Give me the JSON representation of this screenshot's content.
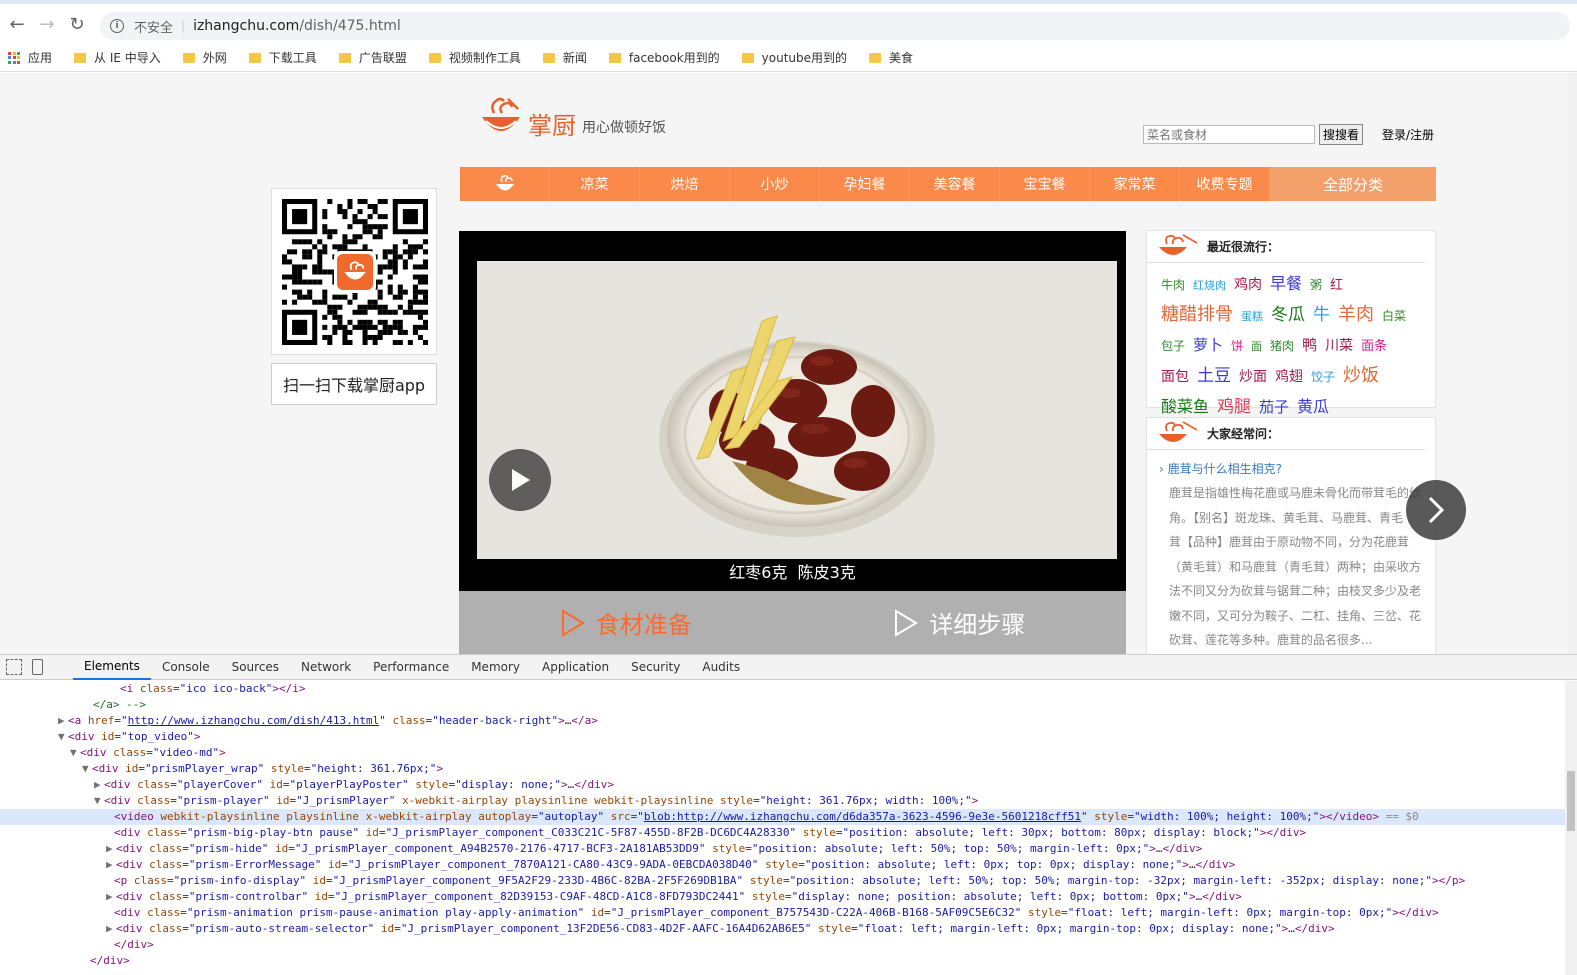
{
  "browser": {
    "security_label": "不安全",
    "url_host": "izhangchu.com",
    "url_path": "/dish/475.html",
    "bookmarks": [
      {
        "label": "应用",
        "icon": "apps-grid-icon"
      },
      {
        "label": "从 IE 中导入",
        "icon": "folder-icon"
      },
      {
        "label": "外网",
        "icon": "folder-icon"
      },
      {
        "label": "下载工具",
        "icon": "folder-icon"
      },
      {
        "label": "广告联盟",
        "icon": "folder-icon"
      },
      {
        "label": "视频制作工具",
        "icon": "folder-icon"
      },
      {
        "label": "新闻",
        "icon": "folder-icon"
      },
      {
        "label": "facebook用到的",
        "icon": "folder-icon"
      },
      {
        "label": "youtube用到的",
        "icon": "folder-icon"
      },
      {
        "label": "美食",
        "icon": "folder-icon"
      }
    ]
  },
  "site": {
    "logo_name": "掌厨",
    "logo_slogan": "用心做顿好饭",
    "search_placeholder": "菜名或食材",
    "search_button": "搜搜看",
    "login": "登录/注册",
    "nav": [
      "凉菜",
      "烘焙",
      "小炒",
      "孕妇餐",
      "美容餐",
      "宝宝餐",
      "家常菜",
      "收费专题"
    ],
    "nav_all": "全部分类",
    "qr_caption": "扫一扫下载掌厨app",
    "video_subtitle": "红枣6克  陈皮3克",
    "video_tabs": [
      "食材准备",
      "详细步骤"
    ],
    "popular": {
      "title": "最近很流行：",
      "tags": [
        {
          "t": "牛肉",
          "c": "#2e8b2e",
          "s": 12
        },
        {
          "t": "红烧肉",
          "c": "#2aa0d8",
          "s": 11
        },
        {
          "t": "鸡肉",
          "c": "#a01c4c",
          "s": 14
        },
        {
          "t": "早餐",
          "c": "#3b3bd8",
          "s": 16
        },
        {
          "t": "粥",
          "c": "#2e8b2e",
          "s": 12
        },
        {
          "t": "红",
          "c": "#a01c4c",
          "s": 13
        },
        {
          "t": "糖醋排骨",
          "c": "#e06a3a",
          "s": 18
        },
        {
          "t": "蛋糕",
          "c": "#2aa0d8",
          "s": 11
        },
        {
          "t": "冬瓜",
          "c": "#1a7a1a",
          "s": 17
        },
        {
          "t": "牛",
          "c": "#2aa0d8",
          "s": 17
        },
        {
          "t": "羊肉",
          "c": "#e06a3a",
          "s": 18
        },
        {
          "t": "白菜",
          "c": "#2e8b2e",
          "s": 12
        },
        {
          "t": "包子",
          "c": "#2e8b2e",
          "s": 12
        },
        {
          "t": "萝卜",
          "c": "#3b3bd8",
          "s": 15
        },
        {
          "t": "饼",
          "c": "#d81c8c",
          "s": 12
        },
        {
          "t": "面",
          "c": "#2e8b2e",
          "s": 11
        },
        {
          "t": "猪肉",
          "c": "#2e8b2e",
          "s": 12
        },
        {
          "t": "鸭",
          "c": "#a01c4c",
          "s": 15
        },
        {
          "t": "川菜",
          "c": "#a01c4c",
          "s": 14
        },
        {
          "t": "面条",
          "c": "#d81c8c",
          "s": 13
        },
        {
          "t": "面包",
          "c": "#a01c4c",
          "s": 14
        },
        {
          "t": "土豆",
          "c": "#3b3bd8",
          "s": 17
        },
        {
          "t": "炒面",
          "c": "#a01c4c",
          "s": 14
        },
        {
          "t": "鸡翅",
          "c": "#a01c4c",
          "s": 14
        },
        {
          "t": "饺子",
          "c": "#2aa0d8",
          "s": 12
        },
        {
          "t": "炒饭",
          "c": "#e06a3a",
          "s": 18
        },
        {
          "t": "酸菜鱼",
          "c": "#1a7a1a",
          "s": 16
        },
        {
          "t": "鸡腿",
          "c": "#e03a5a",
          "s": 17
        },
        {
          "t": "茄子",
          "c": "#3b3bd8",
          "s": 15
        },
        {
          "t": "黄瓜",
          "c": "#3b3bd8",
          "s": 16
        }
      ]
    },
    "faq": {
      "title": "大家经常问：",
      "question": "鹿茸与什么相生相克?",
      "answer_lines": [
        "鹿茸是指雄性梅花鹿或马鹿未骨化而带茸毛的幼",
        "角。【别名】斑龙珠、黄毛茸、马鹿茸、青毛",
        "茸【品种】鹿茸由于原动物不同，分为花鹿茸",
        "（黄毛茸）和马鹿茸（青毛茸）两种；由采收方",
        "法不同又分为砍茸与锯茸二种；由枝叉多少及老",
        "嫩不同，又可分为鞍子、二杠、挂角、三岔、花",
        "砍茸、莲花等多种。鹿茸的品名很多..."
      ]
    }
  },
  "devtools": {
    "tabs": [
      "Elements",
      "Console",
      "Sources",
      "Network",
      "Performance",
      "Memory",
      "Application",
      "Security",
      "Audits"
    ],
    "active_tab": "Elements",
    "lines": [
      {
        "indent": 120,
        "tw": "",
        "html": "<span class='tg'>&lt;i</span> <span class='at'>class</span>=<span class='av'>\"ico ico-back\"</span><span class='tg'>&gt;&lt;/i&gt;</span>"
      },
      {
        "indent": 93,
        "tw": "",
        "html": "<span class='cm'>&lt;/a&gt; --&gt;</span>"
      },
      {
        "indent": 58,
        "tw": "▶",
        "html": "<span class='tg'>&lt;a</span> <span class='at'>href</span>=<span class='av'>\"</span><span class='lk'>http://www.izhangchu.com/dish/413.html</span><span class='av'>\"</span> <span class='at'>class</span>=<span class='av'>\"header-back-right\"</span><span class='tg'>&gt;</span>…<span class='tg'>&lt;/a&gt;</span>"
      },
      {
        "indent": 58,
        "tw": "▼",
        "html": "<span class='tg'>&lt;div</span> <span class='at'>id</span>=<span class='av'>\"top_video\"</span><span class='tg'>&gt;</span>"
      },
      {
        "indent": 70,
        "tw": "▼",
        "html": "<span class='tg'>&lt;div</span> <span class='at'>class</span>=<span class='av'>\"video-md\"</span><span class='tg'>&gt;</span>"
      },
      {
        "indent": 82,
        "tw": "▼",
        "html": "<span class='tg'>&lt;div</span> <span class='at'>id</span>=<span class='av'>\"prismPlayer_wrap\"</span> <span class='at'>style</span>=<span class='av'>\"height: 361.76px;\"</span><span class='tg'>&gt;</span>"
      },
      {
        "indent": 94,
        "tw": "▶",
        "html": "<span class='tg'>&lt;div</span> <span class='at'>class</span>=<span class='av'>\"playerCover\"</span> <span class='at'>id</span>=<span class='av'>\"playerPlayPoster\"</span> <span class='at'>style</span>=<span class='av'>\"display: none;\"</span><span class='tg'>&gt;</span>…<span class='tg'>&lt;/div&gt;</span>"
      },
      {
        "indent": 94,
        "tw": "▼",
        "html": "<span class='tg'>&lt;div</span> <span class='at'>class</span>=<span class='av'>\"prism-player\"</span> <span class='at'>id</span>=<span class='av'>\"J_prismPlayer\"</span> <span class='at'>x-webkit-airplay playsinline webkit-playsinline style</span>=<span class='av'>\"height: 361.76px; width: 100%;\"</span><span class='tg'>&gt;</span>"
      },
      {
        "indent": 114,
        "tw": "",
        "sel": true,
        "html": "<span class='tg'>&lt;video</span> <span class='at'>webkit-playsinline playsinline x-webkit-airplay autoplay</span>=<span class='av'>\"autoplay\"</span> <span class='at'>src</span>=<span class='av'>\"</span><span class='lk'>blob:http://www.izhangchu.com/d6da357a-3623-4596-9e3e-5601218cff51</span><span class='av'>\"</span> <span class='at'>style</span>=<span class='av'>\"width: 100%; height: 100%;\"</span><span class='tg'>&gt;&lt;/video&gt;</span> <span class='gy'>== $0</span>"
      },
      {
        "indent": 114,
        "tw": "",
        "html": "<span class='tg'>&lt;div</span> <span class='at'>class</span>=<span class='av'>\"prism-big-play-btn pause\"</span> <span class='at'>id</span>=<span class='av'>\"J_prismPlayer_component_C033C21C-5F87-455D-8F2B-DC6DC4A28330\"</span> <span class='at'>style</span>=<span class='av'>\"position: absolute; left: 30px; bottom: 80px; display: block;\"</span><span class='tg'>&gt;&lt;/div&gt;</span>"
      },
      {
        "indent": 106,
        "tw": "▶",
        "html": "<span class='tg'>&lt;div</span> <span class='at'>class</span>=<span class='av'>\"prism-hide\"</span> <span class='at'>id</span>=<span class='av'>\"J_prismPlayer_component_A94B2570-2176-4717-BCF3-2A181AB53DD9\"</span> <span class='at'>style</span>=<span class='av'>\"position: absolute; left: 50%; top: 50%; margin-left: 0px;\"</span><span class='tg'>&gt;</span>…<span class='tg'>&lt;/div&gt;</span>"
      },
      {
        "indent": 106,
        "tw": "▶",
        "html": "<span class='tg'>&lt;div</span> <span class='at'>class</span>=<span class='av'>\"prism-ErrorMessage\"</span> <span class='at'>id</span>=<span class='av'>\"J_prismPlayer_component_7870A121-CA80-43C9-9ADA-0EBCDA038D40\"</span> <span class='at'>style</span>=<span class='av'>\"position: absolute; left: 0px; top: 0px; display: none;\"</span><span class='tg'>&gt;</span>…<span class='tg'>&lt;/div&gt;</span>"
      },
      {
        "indent": 114,
        "tw": "",
        "html": "<span class='tg'>&lt;p</span> <span class='at'>class</span>=<span class='av'>\"prism-info-display\"</span> <span class='at'>id</span>=<span class='av'>\"J_prismPlayer_component_9F5A2F29-233D-4B6C-82BA-2F5F269DB1BA\"</span> <span class='at'>style</span>=<span class='av'>\"position: absolute; left: 50%; top: 50%; margin-top: -32px; margin-left: -352px; display: none;\"</span><span class='tg'>&gt;&lt;/p&gt;</span>"
      },
      {
        "indent": 106,
        "tw": "▶",
        "html": "<span class='tg'>&lt;div</span> <span class='at'>class</span>=<span class='av'>\"prism-controlbar\"</span> <span class='at'>id</span>=<span class='av'>\"J_prismPlayer_component_82D39153-C9AF-48CD-A1C8-8FD793DC2441\"</span> <span class='at'>style</span>=<span class='av'>\"display: none; position: absolute; left: 0px; bottom: 0px;\"</span><span class='tg'>&gt;</span>…<span class='tg'>&lt;/div&gt;</span>"
      },
      {
        "indent": 114,
        "tw": "",
        "html": "<span class='tg'>&lt;div</span> <span class='at'>class</span>=<span class='av'>\"prism-animation prism-pause-animation play-apply-animation\"</span> <span class='at'>id</span>=<span class='av'>\"J_prismPlayer_component_B757543D-C22A-406B-B168-5AF09C5E6C32\"</span> <span class='at'>style</span>=<span class='av'>\"float: left; margin-left: 0px; margin-top: 0px;\"</span><span class='tg'>&gt;&lt;/div&gt;</span>"
      },
      {
        "indent": 106,
        "tw": "▶",
        "html": "<span class='tg'>&lt;div</span> <span class='at'>class</span>=<span class='av'>\"prism-auto-stream-selector\"</span> <span class='at'>id</span>=<span class='av'>\"J_prismPlayer_component_13F2DE56-CD83-4D2F-AAFC-16A4D62AB6E5\"</span> <span class='at'>style</span>=<span class='av'>\"float: left; margin-left: 0px; margin-top: 0px; display: none;\"</span><span class='tg'>&gt;</span>…<span class='tg'>&lt;/div&gt;</span>"
      },
      {
        "indent": 114,
        "tw": "",
        "html": "<span class='tg'>&lt;/div&gt;</span>"
      },
      {
        "indent": 90,
        "tw": "",
        "html": "<span class='tg'>&lt;/div&gt;</span>"
      }
    ]
  },
  "colors": {
    "brand_orange": "#fb8a4a",
    "accent_orange": "#e8612c",
    "link_blue": "#3a7bbf"
  }
}
